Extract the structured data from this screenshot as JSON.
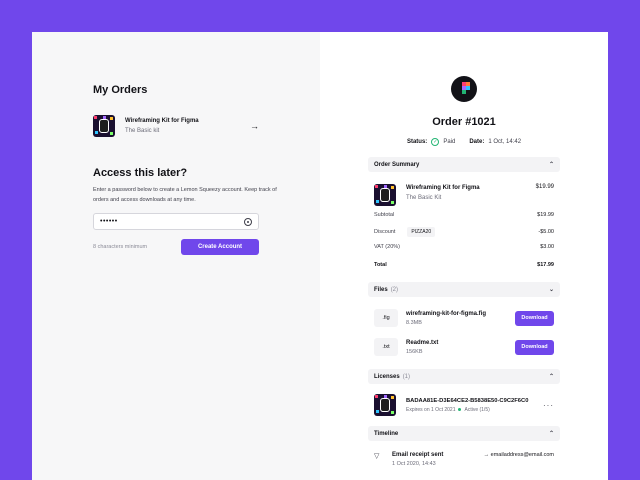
{
  "colors": {
    "accent": "#7047eb",
    "success": "#22b573"
  },
  "left": {
    "my_orders_title": "My Orders",
    "order": {
      "name": "Wireframing Kit for Figma",
      "variant": "The Basic kit"
    },
    "access_title": "Access this later?",
    "access_desc": "Enter a password below to create a Lemon Squeezy account. Keep track of orders and access downloads at any time.",
    "password_value": "••••••",
    "hint": "8 characters minimum",
    "create_button": "Create Account"
  },
  "right": {
    "order_title": "Order #1021",
    "status_label": "Status:",
    "status_value": "Paid",
    "date_label": "Date:",
    "date_value": "1 Oct, 14:42",
    "summary": {
      "title": "Order Summary",
      "item_name": "Wireframing Kit for Figma",
      "item_variant": "The Basic Kit",
      "item_price": "$19.99",
      "subtotal_label": "Subtotal",
      "subtotal": "$19.99",
      "discount_label": "Discount",
      "discount_code": "PIZZA20",
      "discount": "-$5.00",
      "vat_label": "VAT (20%)",
      "vat": "$3.00",
      "total_label": "Total",
      "total": "$17.99"
    },
    "files": {
      "title": "Files",
      "count": "(2)",
      "items": [
        {
          "ext": ".fig",
          "name": "wireframing-kit-for-figma.fig",
          "size": "8.3MB",
          "button": "Download"
        },
        {
          "ext": ".txt",
          "name": "Readme.txt",
          "size": "156KB",
          "button": "Download"
        }
      ]
    },
    "licenses": {
      "title": "Licenses",
      "count": "(1)",
      "key": "BADAA81E-D3E64CE2-B5838E50-C9C2F6C0",
      "expires": "Expires on 1 Oct 2021",
      "state": "Active (1/5)"
    },
    "timeline": {
      "title": "Timeline",
      "event": "Email receipt sent",
      "date": "1 Oct 2020, 14:43",
      "email": "→ emailaddress@email.com"
    }
  }
}
